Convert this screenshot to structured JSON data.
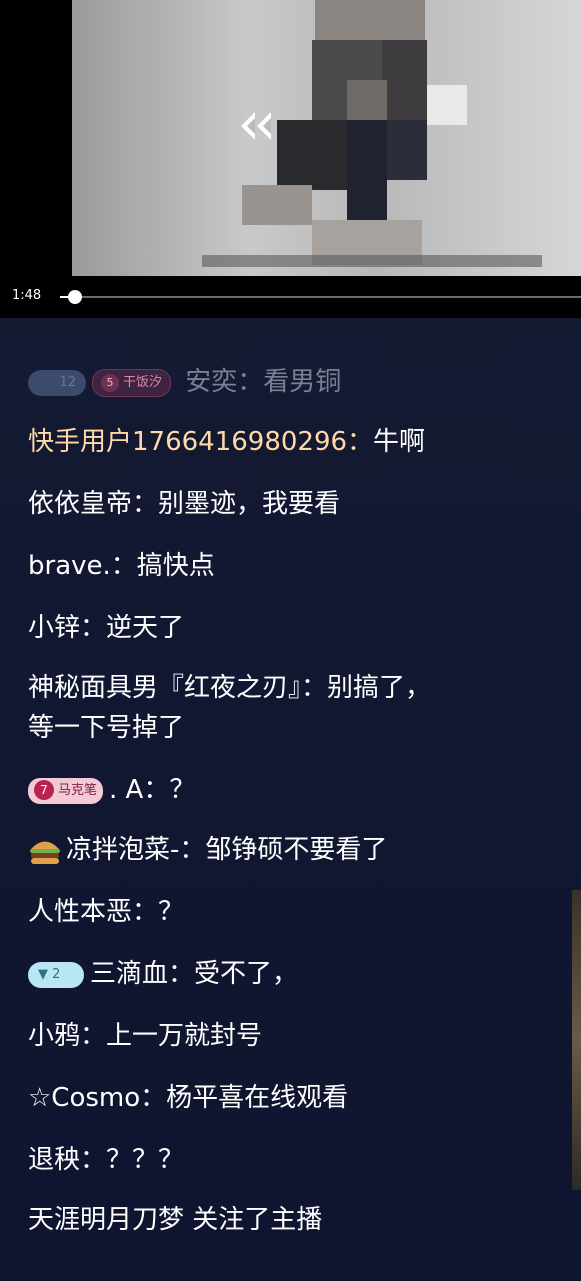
{
  "video": {
    "time": "1:48",
    "progress_pct": 2,
    "rewind_icon": "rewind-double-chevron-icon"
  },
  "badges": {
    "level_num": "12",
    "fan_num": "5",
    "fan_label": "干饭汐",
    "marker_num": "7",
    "marker_label": "马克笔",
    "diamond_num": "2"
  },
  "chat": {
    "messages": [
      {
        "user": "安奕：",
        "text": "看男铜"
      },
      {
        "user": "快手用户1766416980296：",
        "text": "牛啊"
      },
      {
        "user": "依依皇帝：",
        "text": "别墨迹，我要看"
      },
      {
        "user": "brave.：",
        "text": "搞快点"
      },
      {
        "user": "小锌：",
        "text": "逆天了"
      },
      {
        "user": "神秘面具男『红夜之刃』：",
        "text": "别搞了，",
        "text2": "等一下号掉了"
      },
      {
        "user": ". A：",
        "text": "？"
      },
      {
        "user": "凉拌泡菜-：",
        "text": "邹铮硕不要看了"
      },
      {
        "user": "人性本恶：",
        "text": "？"
      },
      {
        "user": "三滴血：",
        "text": "受不了，"
      },
      {
        "user": "小鸦：",
        "text": "上一万就封号"
      },
      {
        "user": "☆Cosmo：",
        "text": "杨平喜在线观看"
      },
      {
        "user": "退秧：",
        "text": "？？？"
      },
      {
        "user": "天涯明月刀梦",
        "text": " 关注了主播"
      }
    ]
  }
}
